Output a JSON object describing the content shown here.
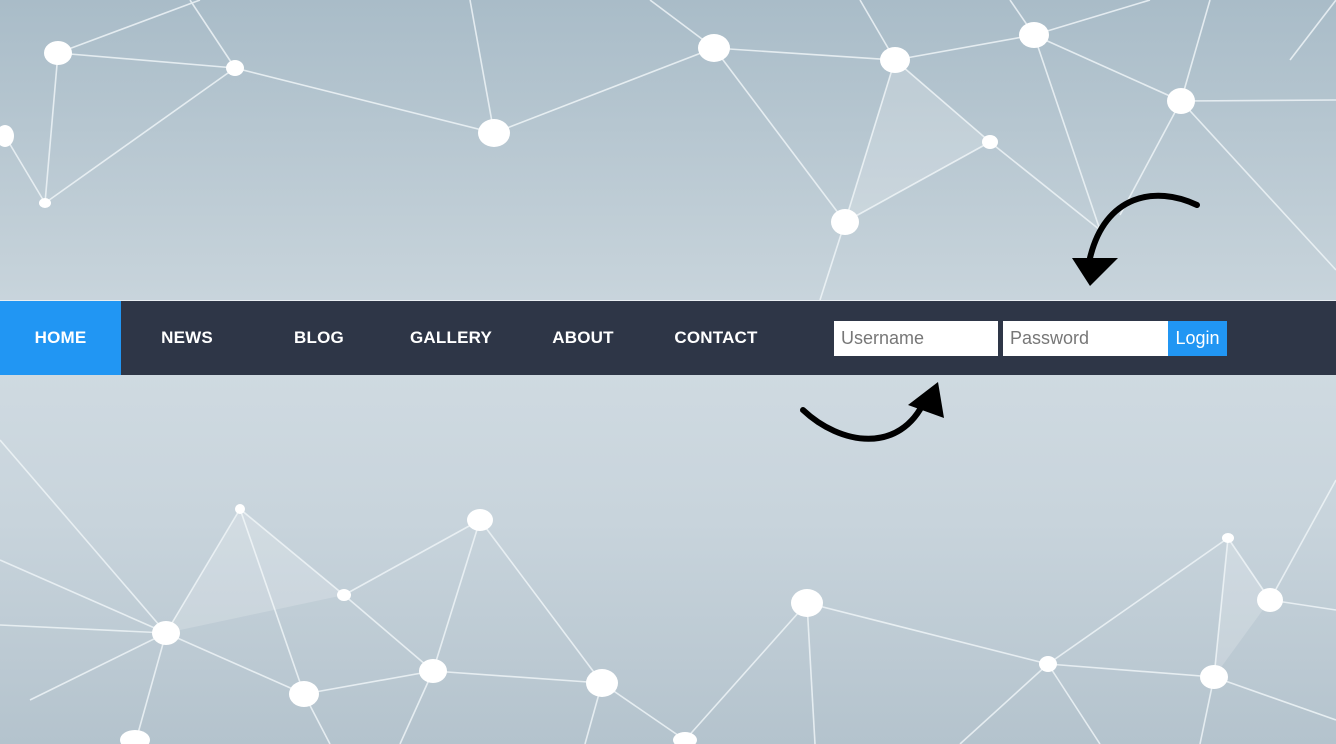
{
  "nav": {
    "items": [
      {
        "label": "HOME",
        "active": true
      },
      {
        "label": "NEWS",
        "active": false
      },
      {
        "label": "BLOG",
        "active": false
      },
      {
        "label": "GALLERY",
        "active": false
      },
      {
        "label": "ABOUT",
        "active": false
      },
      {
        "label": "CONTACT",
        "active": false
      }
    ]
  },
  "login": {
    "username_placeholder": "Username",
    "username_value": "",
    "password_placeholder": "Password",
    "password_value": "",
    "button_label": "Login"
  },
  "colors": {
    "navbar": "#2e3647",
    "accent": "#2196f3",
    "text": "#ffffff",
    "background": "#c4d1d9"
  },
  "decorations": {
    "background": "network-nodes-pattern",
    "annotations": [
      "curved-arrow-icon",
      "curved-arrow-icon"
    ]
  }
}
